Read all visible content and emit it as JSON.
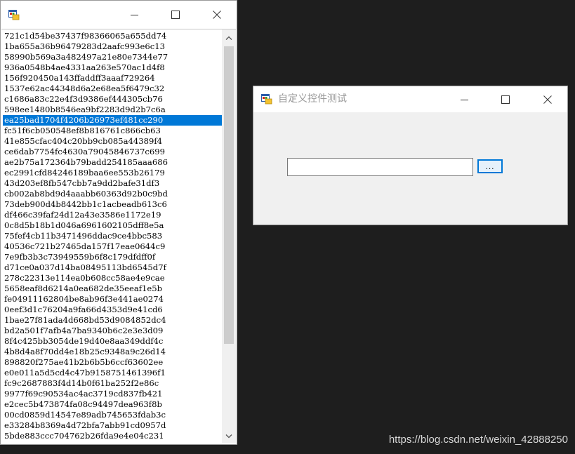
{
  "list_window": {
    "title": "",
    "selected_index": 9,
    "items": [
      "721c1d54be37437f98366065a655dd74",
      "1ba655a36b96479283d2aafc993e6c13",
      "58990b569a3a482497a21e80e7344e77",
      "936a0548b4ae4331aa263e570ac1d4f8",
      "156f920450a143ffaddff3aaaf729264",
      "1537e62ac44348d6a2e68ea5f6479c32",
      "c1686a83c22e4f3d9386ef444305cb76",
      "598ee1480b8546ea9bf2283d9d2b7c6a",
      "ea25bad1704f4206b26973ef481cc290",
      "fc51f6cb050548ef8b816761c866cb63",
      "41e855cfac404c20bb9cb085a44389f4",
      "ce6dab7754fc4630a79045846737c699",
      "ae2b75a172364b79badd254185aaa686",
      "ec2991cfd84246189baa6ee553b26179",
      "43d203ef8fb547cbb7a9dd2bafe31df3",
      "cb002ab8bd9d4aaabb60363d92b0c9bd",
      "73deb900d4b8442bb1c1acbeadb613c6",
      "df466c39faf24d12a43e3586e1172e19",
      "0c8d5b18b1d046a6961602105dff8e5a",
      "75fef4cb11b3471496ddac9ce4bbc583",
      "40536c721b27465da157f17eae0644c9",
      "7e9fb3b3c73949559b6f8c179dfdff0f",
      "d71ce0a037d14ba08495113bd6545d7f",
      "278c22313e114ea0b608cc58ae4e9cae",
      "5658eaf8d6214a0ea682de35eeaf1e5b",
      "fe04911162804be8ab96f3e441ae0274",
      "0eef3d1c76204a9fa66d4353d9e41cd6",
      "1bae27f81ada4d668bd53d9084852dc4",
      "bd2a501f7afb4a7ba9340b6c2e3e3d09",
      "8f4c425bb3054de19d40e8aa349ddf4c",
      "4b8d4a8f70dd4e18b25c9348a9c26d14",
      "898820f275ae41b2b6b5b6ccf63602ee",
      "e0e011a5d5cd4c47b9158751461396f1",
      "fc9c2687883f4d14b0f61ba252f2e86c",
      "9977f69c90534ac4ac3719cd837fb421",
      "e2cec5b473874fa08c94497dea963f8b",
      "00cd0859d14547e89adb745653fdab3c",
      "e33284b8369a4d72bfa7abb91cd0957d",
      "5bde883ccc704762b26fda9e4e04c231"
    ]
  },
  "control_window": {
    "title": "自定义控件测试",
    "input_value": "",
    "browse_label": "..."
  },
  "watermark": "https://blog.csdn.net/weixin_42888250",
  "icons": {
    "app": "app-window-icon",
    "minimize": "minimize-icon",
    "maximize": "maximize-icon",
    "close": "close-icon",
    "scroll_up": "chevron-up-icon",
    "scroll_down": "chevron-down-icon"
  },
  "colors": {
    "selection": "#0078d7",
    "desktop": "#1e1e1e",
    "form_back": "#f0f0f0"
  }
}
